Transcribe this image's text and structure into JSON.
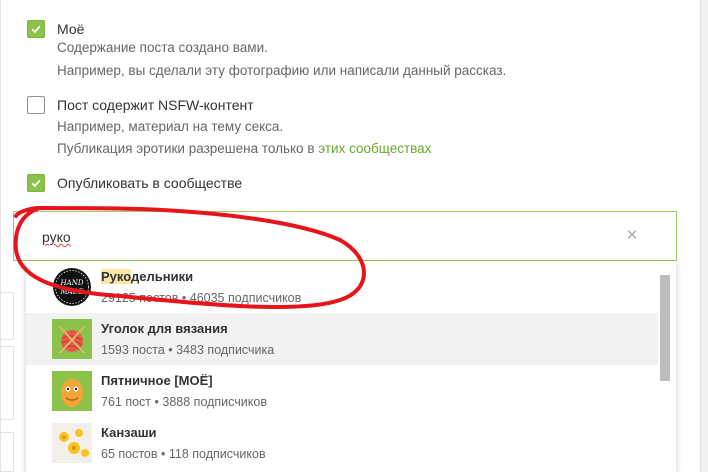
{
  "options": {
    "mine": {
      "label": "Моё",
      "checked": true,
      "desc1": "Содержание поста создано вами.",
      "desc2": "Например, вы сделали эту фотографию или написали данный рассказ."
    },
    "nsfw": {
      "label": "Пост содержит NSFW-контент",
      "checked": false,
      "desc1": "Например, материал на тему секса.",
      "desc2_prefix": "Публикация эротики разрешена только в",
      "desc2_link": "этих сообществах"
    },
    "publish": {
      "label": "Опубликовать в сообществе",
      "checked": true
    }
  },
  "search": {
    "value": "руко",
    "clear_icon": "close-icon"
  },
  "results": [
    {
      "match": "Руко",
      "rest": "дельники",
      "posts": "29125 постов",
      "subs": "46035 подписчиков",
      "avatar": "handmade-avatar"
    },
    {
      "match": "",
      "rest": "Уголок для вязания",
      "posts": "1593 поста",
      "subs": "3483 подписчика",
      "avatar": "yarn-avatar"
    },
    {
      "match": "",
      "rest": "Пятничное [МОЁ]",
      "posts": "761 пост",
      "subs": "3888 подписчиков",
      "avatar": "pumpkin-avatar"
    },
    {
      "match": "",
      "rest": "Канзаши",
      "posts": "65 постов",
      "subs": "118 подписчиков",
      "avatar": "flower-avatar"
    }
  ],
  "separator": "•",
  "colors": {
    "accent": "#8bc34a",
    "link": "#66a82f",
    "highlight": "#fbe6a6",
    "annotation": "#e8141b"
  }
}
